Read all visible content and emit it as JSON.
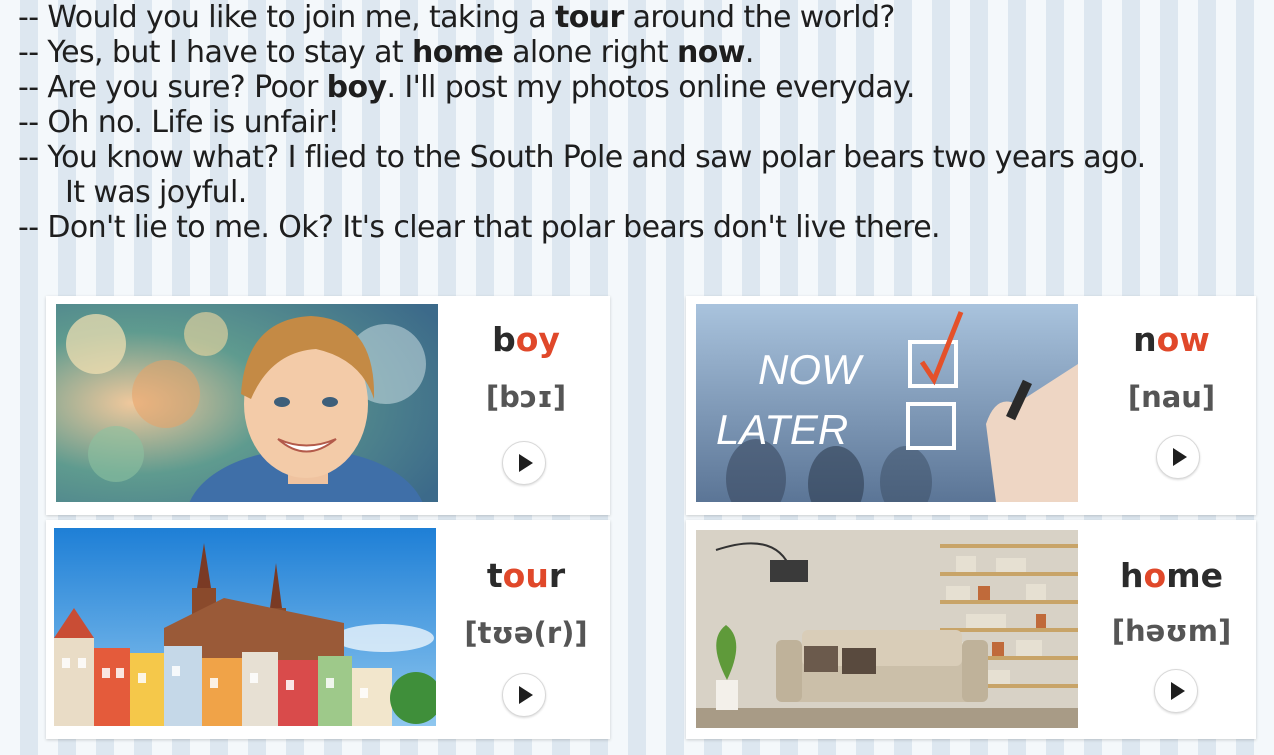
{
  "dialogue": [
    {
      "parts": [
        {
          "t": "-- Would you like to join me, taking a "
        },
        {
          "t": "tour",
          "b": true
        },
        {
          "t": " around the world?"
        }
      ]
    },
    {
      "parts": [
        {
          "t": "-- Yes, but I have to stay at "
        },
        {
          "t": "home",
          "b": true
        },
        {
          "t": " alone right "
        },
        {
          "t": "now",
          "b": true
        },
        {
          "t": "."
        }
      ]
    },
    {
      "parts": [
        {
          "t": "-- Are you sure? Poor "
        },
        {
          "t": "boy",
          "b": true
        },
        {
          "t": ". I'll post my photos online everyday."
        }
      ]
    },
    {
      "parts": [
        {
          "t": "-- Oh no. Life is unfair!"
        }
      ]
    },
    {
      "parts": [
        {
          "t": "-- You know what? I flied to the South Pole and saw polar bears two years ago."
        }
      ],
      "continuation": "It was joyful."
    },
    {
      "parts": [
        {
          "t": "-- Don't lie to me. Ok? It's clear that polar bears don't live there."
        }
      ]
    }
  ],
  "cards": [
    {
      "id": "boy",
      "word_pre": "b",
      "word_hl": "oy",
      "word_post": "",
      "ipa": "[bɔɪ]",
      "image": "boy-photo",
      "play_icon": "play-icon"
    },
    {
      "id": "now",
      "word_pre": "n",
      "word_hl": "ow",
      "word_post": "",
      "ipa": "[nau]",
      "image": "now-later-photo",
      "photo_text": {
        "line1": "NOW",
        "line2": "LATER"
      },
      "play_icon": "play-icon"
    },
    {
      "id": "tour",
      "word_pre": "t",
      "word_hl": "ou",
      "word_post": "r",
      "ipa": "[tʊə(r)]",
      "image": "old-town-photo",
      "play_icon": "play-icon"
    },
    {
      "id": "home",
      "word_pre": "h",
      "word_hl": "o",
      "word_post": "me",
      "ipa": "[həʊm]",
      "image": "living-room-photo",
      "play_icon": "play-icon"
    }
  ],
  "colors": {
    "highlight": "#e0482a",
    "text": "#1e1e1e",
    "ipa": "#555555",
    "stripe_light": "#f4f8fb",
    "stripe_dark": "#dde7f0"
  }
}
